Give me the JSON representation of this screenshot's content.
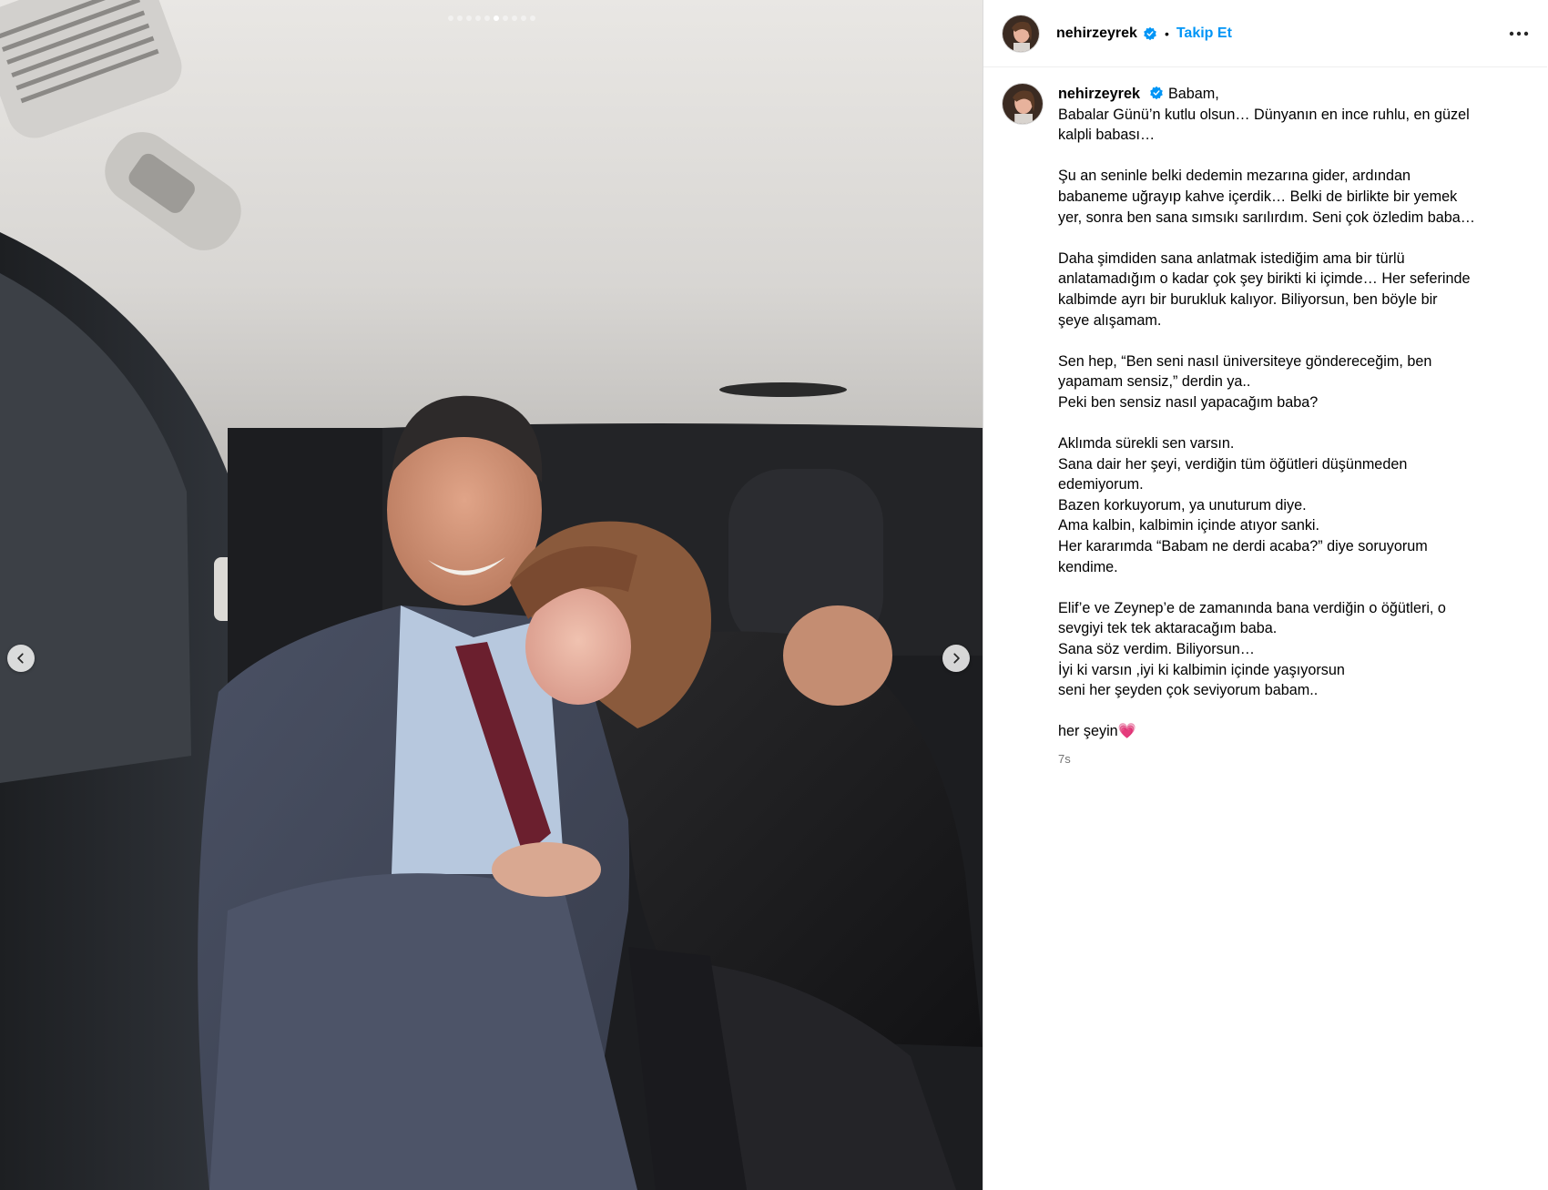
{
  "carousel": {
    "total": 10,
    "active_index": 5
  },
  "post": {
    "username": "nehirzeyrek",
    "verified": true,
    "separator": "•",
    "follow_label": "Takip Et",
    "more_icon": "more-horizontal-icon"
  },
  "caption": {
    "username": "nehirzeyrek",
    "first_line": "Babam,",
    "paragraphs": [
      [
        "Babalar Günü’n kutlu olsun… Dünyanın en ince ruhlu, en güzel",
        "kalpli babası…"
      ],
      [
        "Şu an seninle belki dedemin mezarına gider, ardından",
        "babaneme uğrayıp kahve içerdik… Belki de birlikte bir yemek",
        "yer, sonra ben sana sımsıkı sarılırdım. Seni çok özledim baba…"
      ],
      [
        "Daha şimdiden sana anlatmak istediğim ama bir türlü",
        "anlatamadığım o kadar çok şey birikti ki içimde… Her seferinde",
        "kalbimde ayrı bir burukluk kalıyor. Biliyorsun, ben böyle bir",
        "şeye alışamam."
      ],
      [
        "Sen hep, “Ben seni nasıl üniversiteye göndereceğim, ben",
        "yapamam sensiz,” derdin ya..",
        "Peki ben sensiz nasıl yapacağım baba?"
      ],
      [
        "Aklımda sürekli sen varsın.",
        "Sana dair her şeyi, verdiğin tüm öğütleri düşünmeden",
        "edemiyorum.",
        "Bazen korkuyorum, ya unuturum diye.",
        "Ama kalbin, kalbimin içinde atıyor sanki.",
        "Her kararımda “Babam ne derdi acaba?” diye soruyorum",
        "kendime."
      ],
      [
        "Elif’e ve Zeynep’e de zamanında bana verdiğin o öğütleri, o",
        "sevgiyi tek tek aktaracağım baba.",
        "Sana söz verdim. Biliyorsun…",
        "İyi ki varsın ,iyi ki kalbimin içinde yaşıyorsun",
        "seni her şeyden çok seviyorum babam.."
      ],
      [
        "her şeyin💗"
      ]
    ],
    "timestamp": "7s"
  },
  "colors": {
    "accent": "#0095f6",
    "verified_badge": "#0095f6",
    "secondary_text": "#737373"
  }
}
